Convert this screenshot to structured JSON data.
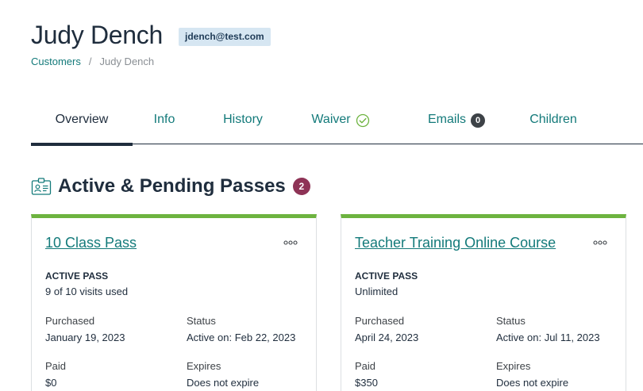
{
  "header": {
    "customer_name": "Judy Dench",
    "email": "jdench@test.com"
  },
  "breadcrumb": {
    "parent": "Customers",
    "separator": "/",
    "current": "Judy Dench"
  },
  "tabs": [
    {
      "label": "Overview",
      "active": true
    },
    {
      "label": "Info"
    },
    {
      "label": "History"
    },
    {
      "label": "Waiver",
      "icon": "check-circle-icon"
    },
    {
      "label": "Emails",
      "count": "0"
    },
    {
      "label": "Children"
    }
  ],
  "section": {
    "title": "Active & Pending Passes",
    "count": "2",
    "icon": "id-card-icon"
  },
  "passes": [
    {
      "name": "10 Class Pass",
      "state": "ACTIVE PASS",
      "usage": "9 of 10 visits used",
      "purchased_label": "Purchased",
      "purchased": "January 19, 2023",
      "status_label": "Status",
      "status": "Active on: Feb 22, 2023",
      "paid_label": "Paid",
      "paid": "$0",
      "expires_label": "Expires",
      "expires": "Does not expire"
    },
    {
      "name": "Teacher Training Online Course",
      "state": "ACTIVE PASS",
      "usage": "Unlimited",
      "purchased_label": "Purchased",
      "purchased": "April 24, 2023",
      "status_label": "Status",
      "status": "Active on: Jul 11, 2023",
      "paid_label": "Paid",
      "paid": "$350",
      "expires_label": "Expires",
      "expires": "Does not expire"
    }
  ],
  "colors": {
    "teal_link": "#137a7a",
    "card_accent": "#6db33f",
    "count_badge": "#8e3356",
    "email_badge_bg": "#d6e6f2"
  }
}
